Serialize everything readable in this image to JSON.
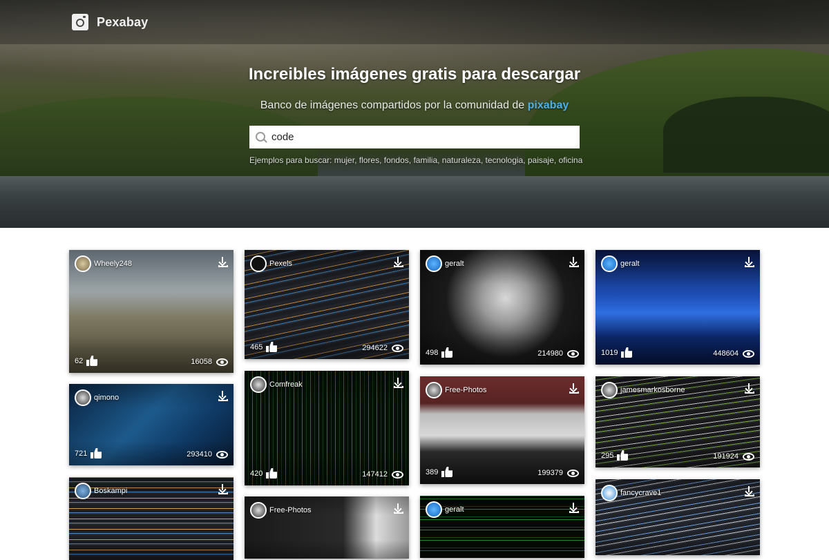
{
  "header": {
    "brand": "Pexabay"
  },
  "hero": {
    "title": "Increibles imágenes gratis para descargar",
    "subtitle_prefix": "Banco de imágenes compartidos por la comunidad de",
    "subtitle_link": "pixabay",
    "search_value": "code",
    "examples": "Ejemplos para buscar: mujer, flores, fondos, familia, naturaleza, tecnologia, paisaje, oficina"
  },
  "cards": [
    {
      "user": "Wheely248",
      "likes": "62",
      "views": "16058",
      "avatar": "sheep-avatar",
      "bg": "linear-gradient(180deg,#7d8a95 0%,#9aa2a4 35%,#7f7a63 55%,#5e5a45 80%,#4b4636 100%)"
    },
    {
      "user": "Pexels",
      "likes": "465",
      "views": "294622",
      "avatar": "pexels-avatar",
      "bg": "repeating-linear-gradient(-12deg,#1b1d22 0 6px,#2a2c33 6px 8px,#3b7bb0 8px 9px,#1b1d22 9px 14px,#b98540 14px 15px,#22242a 15px 20px)"
    },
    {
      "user": "geralt",
      "likes": "498",
      "views": "214980",
      "avatar": "geralt-avatar",
      "bg": "radial-gradient(circle at 52% 42%,#d8d8d8 0%,#9b9b9b 22%,#555 40%,#1a1a1a 55%,#0c0c0c 100%)"
    },
    {
      "user": "geralt",
      "likes": "1019",
      "views": "448604",
      "avatar": "geralt-avatar",
      "bg": "linear-gradient(180deg,#0a1a4a 0%,#1e4fb8 40%,#2f6fe0 55%,#0d2a70 75%,#071540 100%)"
    },
    {
      "user": "qimono",
      "likes": "721",
      "views": "293410",
      "avatar": "qimono-avatar",
      "bg": "linear-gradient(135deg,#0a2340 0%,#1d5a8c 45%,#0f3a66 70%,#081a30 100%)"
    },
    {
      "user": "Comfreak",
      "likes": "420",
      "views": "147412",
      "avatar": "comfreak-avatar",
      "bg": "repeating-linear-gradient(90deg,#041006 0 5px,#0d3d12 5px 6px,#041006 6px 11px,#1f7a22 11px 12px)"
    },
    {
      "user": "Free-Photos",
      "likes": "389",
      "views": "199379",
      "avatar": "freephotos-avatar",
      "bg": "linear-gradient(180deg,#8c3a3a 0%,#5a2424 25%,#bcbcbc 35%,#d8d8d8 55%,#2a2a2a 70%,#141414 100%)"
    },
    {
      "user": "jamesmarkosborne",
      "likes": "295",
      "views": "191924",
      "avatar": "james-avatar",
      "bg": "repeating-linear-gradient(-8deg,#1a1a1c 0 6px,#2c2c2f 6px 8px,#7ab04a 8px 9px,#1a1a1c 9px 14px,#c7c7c7 14px 15px)"
    },
    {
      "user": "Boskampi",
      "likes": "",
      "views": "",
      "avatar": "boskampi-avatar",
      "bg": "repeating-linear-gradient(0deg,#1e1f24 0 6px,#2b2d34 6px 8px,#4e8bc6 8px 9px,#1e1f24 9px 14px,#d0a050 14px 15px)"
    },
    {
      "user": "Free-Photos",
      "likes": "",
      "views": "",
      "avatar": "freephotos-avatar",
      "bg": "linear-gradient(90deg,#1a1a1a 0%,#2a2a2a 60%,#dcdcdc 80%,#9a9a9a 100%)"
    },
    {
      "user": "geralt",
      "likes": "",
      "views": "",
      "avatar": "geralt-avatar",
      "bg": "repeating-linear-gradient(0deg,#050a05 0 10px,#1c8a2c 10px 11px,#050a05 11px 14px,#0f4d18 14px 15px)"
    },
    {
      "user": "fancycrave1",
      "likes": "",
      "views": "",
      "avatar": "fancy-avatar",
      "bg": "repeating-linear-gradient(-10deg,#20232a 0 6px,#2e323a 6px 8px,#c9c9c9 8px 9px,#20232a 9px 14px,#6fa0d8 14px 15px)"
    }
  ]
}
